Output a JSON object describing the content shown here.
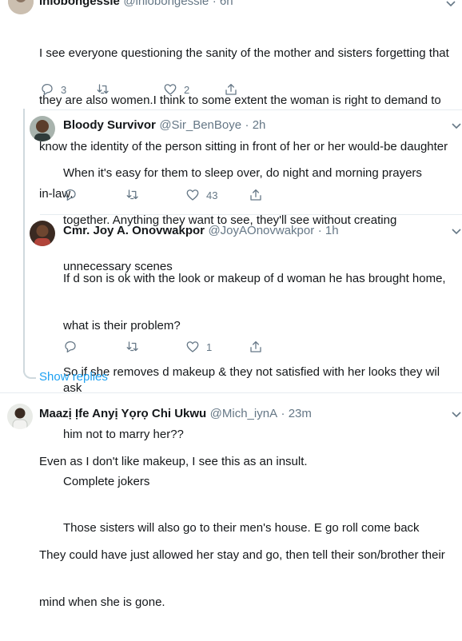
{
  "tweet1": {
    "name": "iniobongessie",
    "handle": "@iniobongessie",
    "time": "· 6h",
    "lines": [
      "I see everyone questioning the sanity of the mother and sisters forgetting that",
      "they are also women.I think to some extent the woman is right to demand to",
      "know the identity of the person sitting in front of her or her would-be daughter",
      "in-law."
    ],
    "reply_count": "3",
    "retweet_count": "",
    "like_count": "2"
  },
  "reply1": {
    "name": "Bloody Survivor",
    "handle": "@Sir_BenBoye",
    "time": "· 2h",
    "lines": [
      "When it's easy for them to sleep over, do night and morning prayers",
      "together. Anything they want to see, they'll see without creating",
      "unnecessary scenes"
    ],
    "reply_count": "",
    "retweet_count": "",
    "like_count": "43"
  },
  "reply2": {
    "name": "Cmr. Joy A. Onovwakpor",
    "handle": "@JoyAOnovwakpor",
    "time": "· 1h",
    "lines": [
      "If d son is ok with the look or makeup of d woman he has brought home,",
      "what is their problem?",
      "So if she removes d makeup & they not satisfied with her looks they wil ask",
      "him not to marry her??",
      "Complete jokers",
      "Those sisters will also go to their men's house. E go roll come back"
    ],
    "reply_count": "",
    "retweet_count": "",
    "like_count": "1"
  },
  "show_replies": "Show replies",
  "tweet2": {
    "name": "Maazị Ịfe Anyị Yọrọ Chi Ukwu",
    "handle": "@Mich_iynA",
    "time": "· 23m",
    "lines": [
      "Even as I don't like makeup, I see this as an insult.",
      "",
      "They could have just allowed her stay and go, then tell their son/brother their",
      "mind when she is gone."
    ]
  },
  "icons": {
    "reply": "reply-icon",
    "retweet": "retweet-icon",
    "like": "heart-icon",
    "share": "share-icon",
    "more": "chevron-down-icon"
  },
  "colors": {
    "text": "#14171a",
    "secondary": "#657786",
    "link": "#1da1f2",
    "divider": "#e6ecf0",
    "thread": "#cfd9de"
  }
}
